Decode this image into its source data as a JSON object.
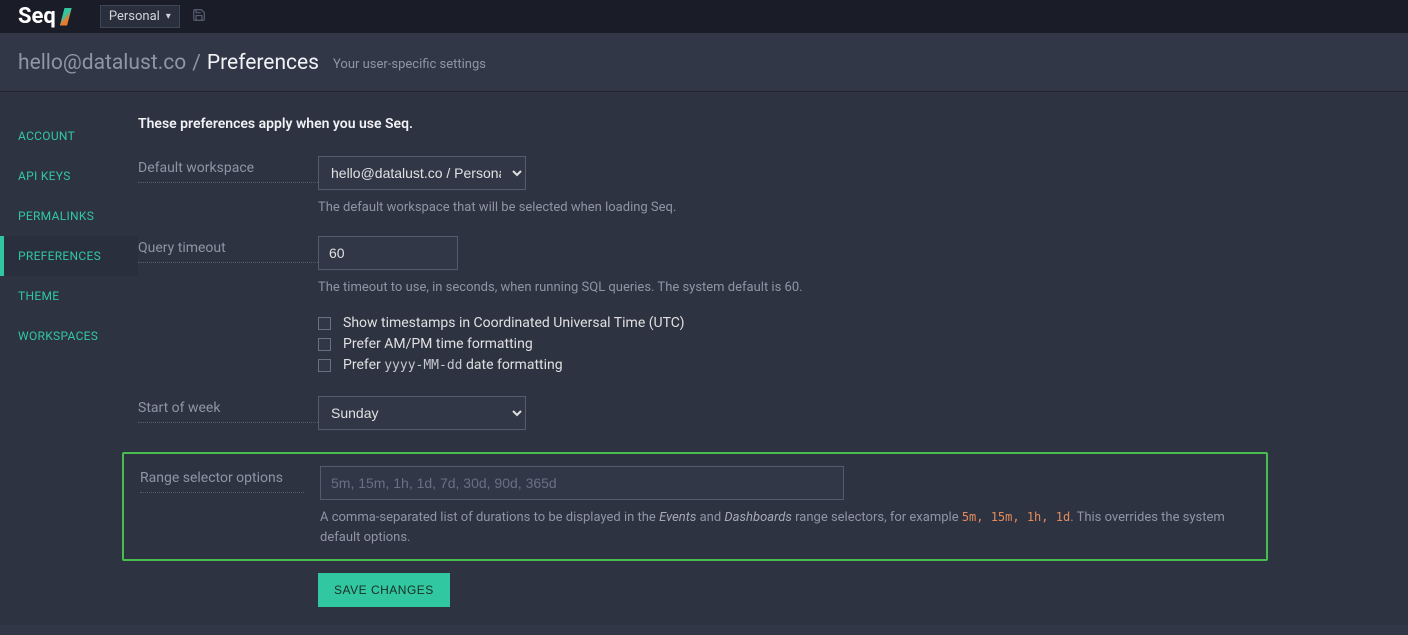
{
  "topbar": {
    "logo_text": "Seq",
    "workspace_label": "Personal"
  },
  "header": {
    "user": "hello@datalust.co",
    "sep": "/",
    "page": "Preferences",
    "subtitle": "Your user-specific settings"
  },
  "sidebar": {
    "items": [
      "ACCOUNT",
      "API KEYS",
      "PERMALINKS",
      "PREFERENCES",
      "THEME",
      "WORKSPACES"
    ],
    "active_index": 3
  },
  "content": {
    "intro": "These preferences apply when you use Seq.",
    "default_workspace": {
      "label": "Default workspace",
      "value": "hello@datalust.co / Personal",
      "help": "The default workspace that will be selected when loading Seq."
    },
    "query_timeout": {
      "label": "Query timeout",
      "value": "60",
      "help": "The timeout to use, in seconds, when running SQL queries. The system default is 60."
    },
    "checkboxes": {
      "utc": "Show timestamps in Coordinated Universal Time (UTC)",
      "ampm": "Prefer AM/PM time formatting",
      "ymd_prefix": "Prefer ",
      "ymd_code": "yyyy-MM-dd",
      "ymd_suffix": " date formatting"
    },
    "start_of_week": {
      "label": "Start of week",
      "value": "Sunday"
    },
    "range_selector": {
      "label": "Range selector options",
      "placeholder": "5m, 15m, 1h, 1d, 7d, 30d, 90d, 365d",
      "help_prefix": "A comma-separated list of durations to be displayed in the ",
      "help_em1": "Events",
      "help_mid": " and ",
      "help_em2": "Dashboards",
      "help_after_em": " range selectors, for example ",
      "help_code": "5m, 15m, 1h, 1d",
      "help_suffix": ". This overrides the system default options."
    },
    "save_button": "SAVE CHANGES"
  }
}
